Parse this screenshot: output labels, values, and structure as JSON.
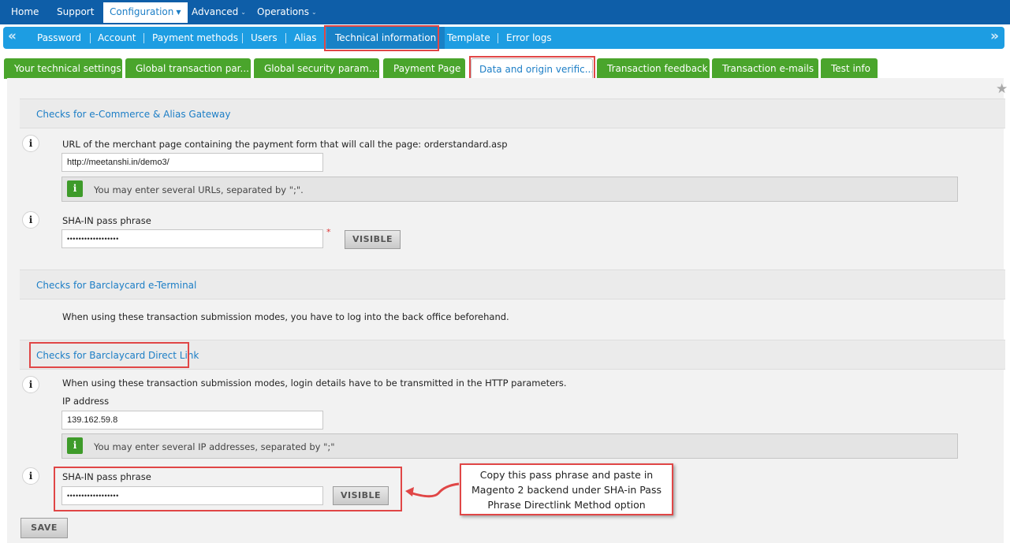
{
  "topnav": {
    "items": [
      {
        "label": "Home"
      },
      {
        "label": "Support"
      },
      {
        "label": "Configuration"
      },
      {
        "label": "Advanced"
      },
      {
        "label": "Operations"
      }
    ]
  },
  "subnav": {
    "items": [
      {
        "label": "Password"
      },
      {
        "label": "Account"
      },
      {
        "label": "Payment methods"
      },
      {
        "label": "Users"
      },
      {
        "label": "Alias"
      },
      {
        "label": "Technical information"
      },
      {
        "label": "Template"
      },
      {
        "label": "Error logs"
      }
    ],
    "prev_symbol": "«",
    "next_symbol": "»"
  },
  "tabs": [
    {
      "label": "Your technical settings"
    },
    {
      "label": "Global transaction par..."
    },
    {
      "label": "Global security param..."
    },
    {
      "label": "Payment Page"
    },
    {
      "label": "Data and origin verific..."
    },
    {
      "label": "Transaction feedback"
    },
    {
      "label": "Transaction e-mails"
    },
    {
      "label": "Test info"
    }
  ],
  "ecommerce": {
    "title": "Checks for e-Commerce & Alias Gateway",
    "url_label": "URL of the merchant page containing the payment form that will call the page: orderstandard.asp",
    "url_value": "http://meetanshi.in/demo3/",
    "url_hint": "You may enter several URLs, separated by \";\".",
    "sha_label": "SHA-IN pass phrase",
    "sha_value": "••••••••••••••••••",
    "required_mark": "*",
    "visible_button": "VISIBLE"
  },
  "eterminal": {
    "title": "Checks for Barclaycard e-Terminal",
    "text": "When using these transaction submission modes, you have to log into the back office beforehand."
  },
  "directlink": {
    "title": "Checks for Barclaycard Direct Link",
    "text": "When using these transaction submission modes, login details have to be transmitted in the HTTP parameters.",
    "ip_label": "IP address",
    "ip_value": "139.162.59.8",
    "ip_hint": "You may enter several IP addresses, separated by \";\"",
    "sha_label": "SHA-IN pass phrase",
    "sha_value": "••••••••••••••••••",
    "visible_button": "VISIBLE"
  },
  "save_button": "SAVE",
  "info_glyph": "i",
  "callout": {
    "line1": "Copy this pass phrase and paste in",
    "line2": "Magento 2 backend under SHA-in Pass",
    "line3": "Phrase Directlink Method option"
  },
  "colors": {
    "topnav": "#0e5ea8",
    "subnav": "#1d9de2",
    "tab_green": "#4aa52c",
    "link_blue": "#1c7ec6",
    "highlight_red": "#e04646"
  }
}
